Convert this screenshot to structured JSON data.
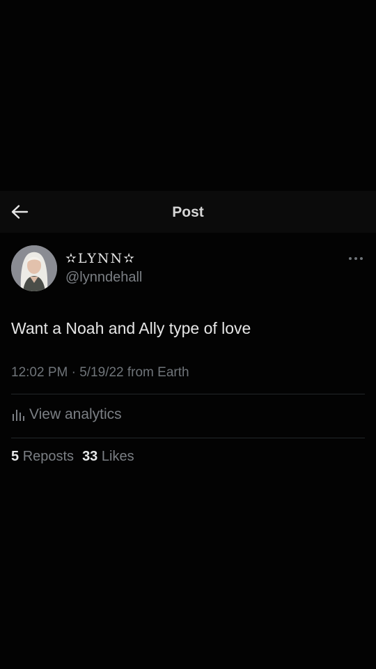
{
  "header": {
    "title": "Post",
    "back_icon": "arrow-left-icon"
  },
  "author": {
    "display_name": "✫LYNN✫",
    "handle": "@lynndehall",
    "avatar_icon": "profile-photo"
  },
  "more_icon": "more-horizontal-icon",
  "tweet": {
    "text": "Want a Noah and Ally type of love",
    "timestamp": "12:02 PM · 5/19/22 from Earth"
  },
  "analytics": {
    "icon": "bar-chart-icon",
    "label": "View analytics"
  },
  "stats": {
    "reposts_count": "5",
    "reposts_label": "Reposts",
    "likes_count": "33",
    "likes_label": "Likes"
  },
  "colors": {
    "background": "#030303",
    "header_background": "#0b0b0b",
    "primary_text": "#e7e9ea",
    "secondary_text": "#7b7f84",
    "divider": "#23272a"
  }
}
